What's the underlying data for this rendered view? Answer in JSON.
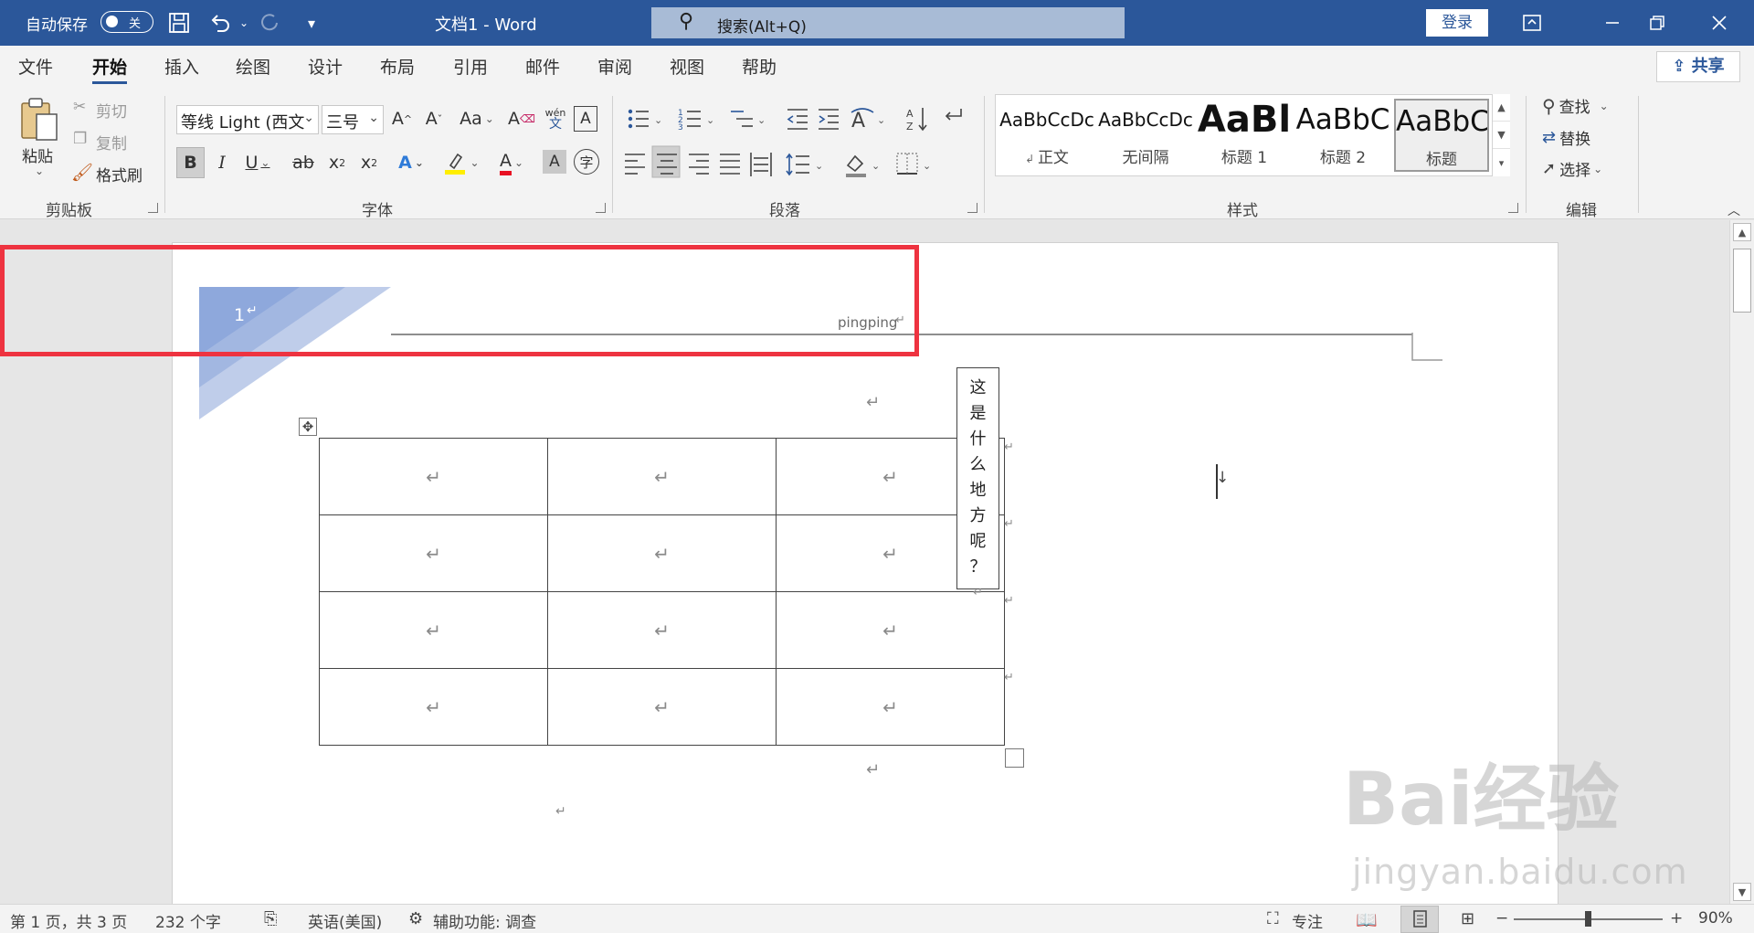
{
  "titlebar": {
    "autosave_label": "自动保存",
    "autosave_state": "关",
    "doc_title": "文档1  -  Word",
    "search_placeholder": "搜索(Alt+Q)",
    "login_label": "登录",
    "bg_color": "#2b579a"
  },
  "ribbon": {
    "tabs": [
      "文件",
      "开始",
      "插入",
      "绘图",
      "设计",
      "布局",
      "引用",
      "邮件",
      "审阅",
      "视图",
      "帮助"
    ],
    "active_tab": "开始",
    "share_label": "共享",
    "clipboard": {
      "paste": "粘贴",
      "cut": "剪切",
      "copy": "复制",
      "format_painter": "格式刷",
      "group_label": "剪贴板"
    },
    "font": {
      "font_name": "等线 Light (西文",
      "font_size": "三号",
      "grow": "A",
      "shrink": "A",
      "case": "Aa",
      "phonetic_top": "wén",
      "phonetic_bottom": "文",
      "bold": "B",
      "italic": "I",
      "underline": "U",
      "strike": "ab",
      "subscript": "x",
      "superscript": "x",
      "effects": "A",
      "font_color": "A",
      "shading": "A",
      "enclose": "字",
      "group_label": "字体"
    },
    "paragraph": {
      "group_label": "段落"
    },
    "styles": {
      "items": [
        {
          "sample": "AaBbCcDc",
          "name": "正文"
        },
        {
          "sample": "AaBbCcDc",
          "name": "无间隔"
        },
        {
          "sample": "AaBl",
          "name": "标题 1"
        },
        {
          "sample": "AaBbC",
          "name": "标题 2"
        },
        {
          "sample": "AaBbC",
          "name": "标题"
        }
      ],
      "group_label": "样式"
    },
    "editing": {
      "find": "查找",
      "replace": "替换",
      "select": "选择",
      "group_label": "编辑"
    }
  },
  "document": {
    "header_page_number": "1",
    "header_text": "pingping",
    "textbox_chars": [
      "这",
      "是",
      "什",
      "么",
      "地",
      "方",
      "呢",
      "？"
    ],
    "table": {
      "rows": 4,
      "cols": 3,
      "cell_mark": "↵"
    },
    "para_mark": "↵"
  },
  "statusbar": {
    "page_info": "第 1 页，共 3 页",
    "word_count": "232 个字",
    "language": "英语(美国)",
    "accessibility": "辅助功能: 调查",
    "focus": "专注",
    "zoom_level": "90%",
    "zoom_minus": "−",
    "zoom_plus": "+"
  },
  "watermark": {
    "main": "Bai经验",
    "sub": "jingyan.baidu.com"
  },
  "colors": {
    "highlight_box": "#ee3340",
    "accent": "#2b579a"
  }
}
